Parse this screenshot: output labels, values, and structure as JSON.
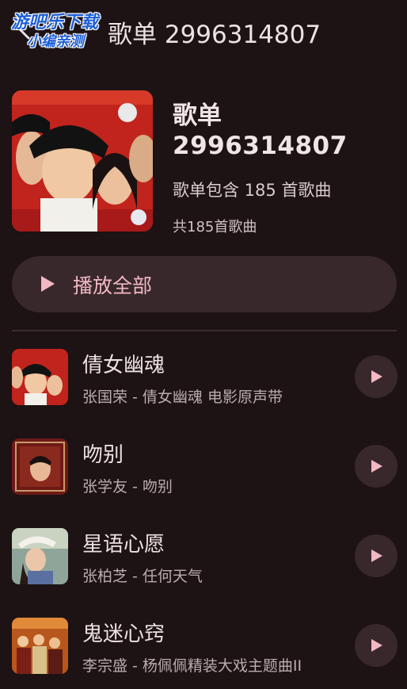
{
  "topbar": {
    "title": "歌单 2996314807",
    "watermark_line1": "游吧乐下载",
    "watermark_line2": "小编亲测"
  },
  "playlist": {
    "name_line1": "歌单",
    "name_line2": "2996314807",
    "count_text": "歌单包含 185 首歌曲",
    "total_text": "共185首歌曲"
  },
  "play_all": {
    "label": "播放全部"
  },
  "songs": [
    {
      "title": "倩女幽魂",
      "subtitle": "张国荣 - 倩女幽魂 电影原声带"
    },
    {
      "title": "吻别",
      "subtitle": "张学友 - 吻别"
    },
    {
      "title": "星语心愿",
      "subtitle": "张柏芝 - 任何天气"
    },
    {
      "title": "鬼迷心窍",
      "subtitle": "李宗盛 - 杨佩佩精装大戏主题曲II"
    }
  ],
  "colors": {
    "background": "#1d1214",
    "surface": "#38282b",
    "accent": "#f2b8c4"
  }
}
